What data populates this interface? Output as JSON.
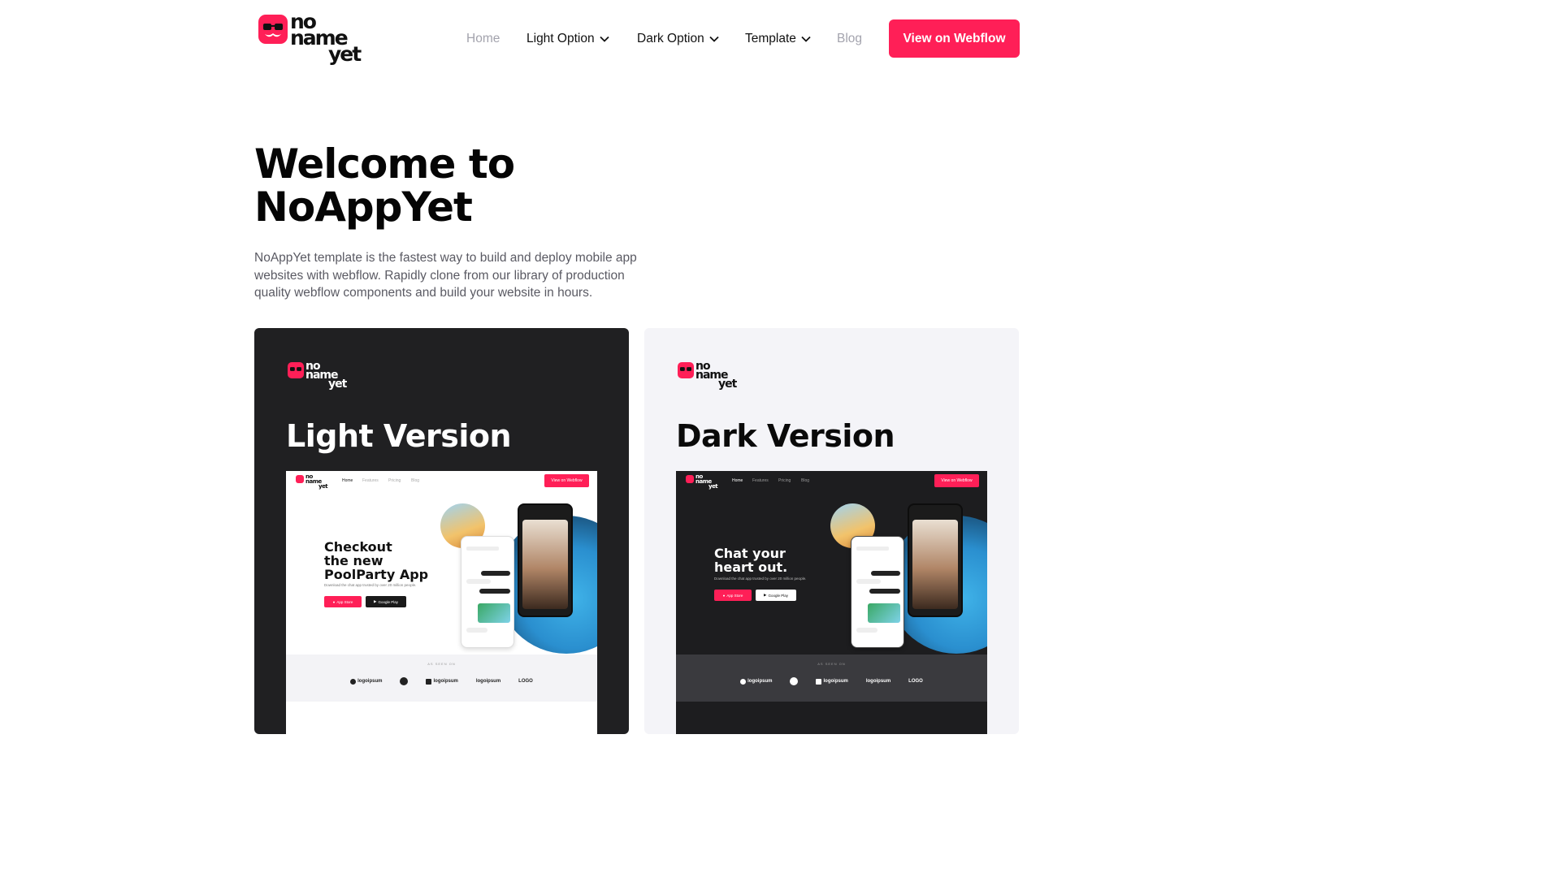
{
  "brand": {
    "logo_line1": "no",
    "logo_line2": "name",
    "logo_line3": "yet",
    "accent": "#ff1f57"
  },
  "nav": {
    "home": "Home",
    "light_option": "Light Option",
    "dark_option": "Dark Option",
    "template": "Template",
    "blog": "Blog",
    "cta": "View on Webflow"
  },
  "hero": {
    "title_line1": "Welcome to",
    "title_line2": "NoAppYet",
    "description": "NoAppYet template is the fastest way to build and deploy mobile app websites with webflow. Rapidly clone from our library of production quality webflow components and build your website in hours."
  },
  "cards": [
    {
      "title": "Light Version",
      "preview": {
        "nav_home": "Home",
        "nav_features": "Features",
        "nav_pricing": "Pricing",
        "nav_blog": "Blog",
        "cta": "View on Webflow",
        "headline_l1": "Checkout",
        "headline_l2": "the new",
        "headline_l3": "PoolParty App",
        "sub": "Download the chat app trusted by over 20 million people.",
        "btn_app_store": "App Store",
        "btn_google_play": "Google Play",
        "as_seen_on": "AS SEEN ON",
        "logo_a": "logoipsum",
        "logo_b": "logoipsum",
        "logo_c": "logoipsum",
        "logo_d": "LOGO"
      }
    },
    {
      "title": "Dark Version",
      "preview": {
        "nav_home": "Home",
        "nav_features": "Features",
        "nav_pricing": "Pricing",
        "nav_blog": "Blog",
        "cta": "View on Webflow",
        "headline_l1": "Chat your",
        "headline_l2": "heart out.",
        "sub": "Download the chat app trusted by over 20 million people.",
        "btn_app_store": "App Store",
        "btn_google_play": "Google Play",
        "as_seen_on": "AS SEEN ON",
        "logo_a": "logoipsum",
        "logo_b": "logoipsum",
        "logo_c": "logoipsum",
        "logo_d": "LOGO"
      }
    }
  ]
}
